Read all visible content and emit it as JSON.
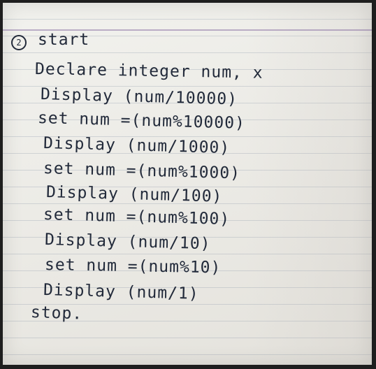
{
  "handwriting": {
    "step_marker": "2",
    "lines": [
      "start",
      "Declare integer num, x",
      "Display (num/10000)",
      "set num =(num%10000)",
      "Display (num/1000)",
      "set num =(num%1000)",
      "Display (num/100)",
      "set num =(num%100)",
      "Display (num/10)",
      "set num =(num%10)",
      "Display (num/1)",
      "stop."
    ]
  },
  "colors": {
    "ink": "#222a3a",
    "paper": "#ecebe6",
    "rule_line": "#96a0af"
  }
}
